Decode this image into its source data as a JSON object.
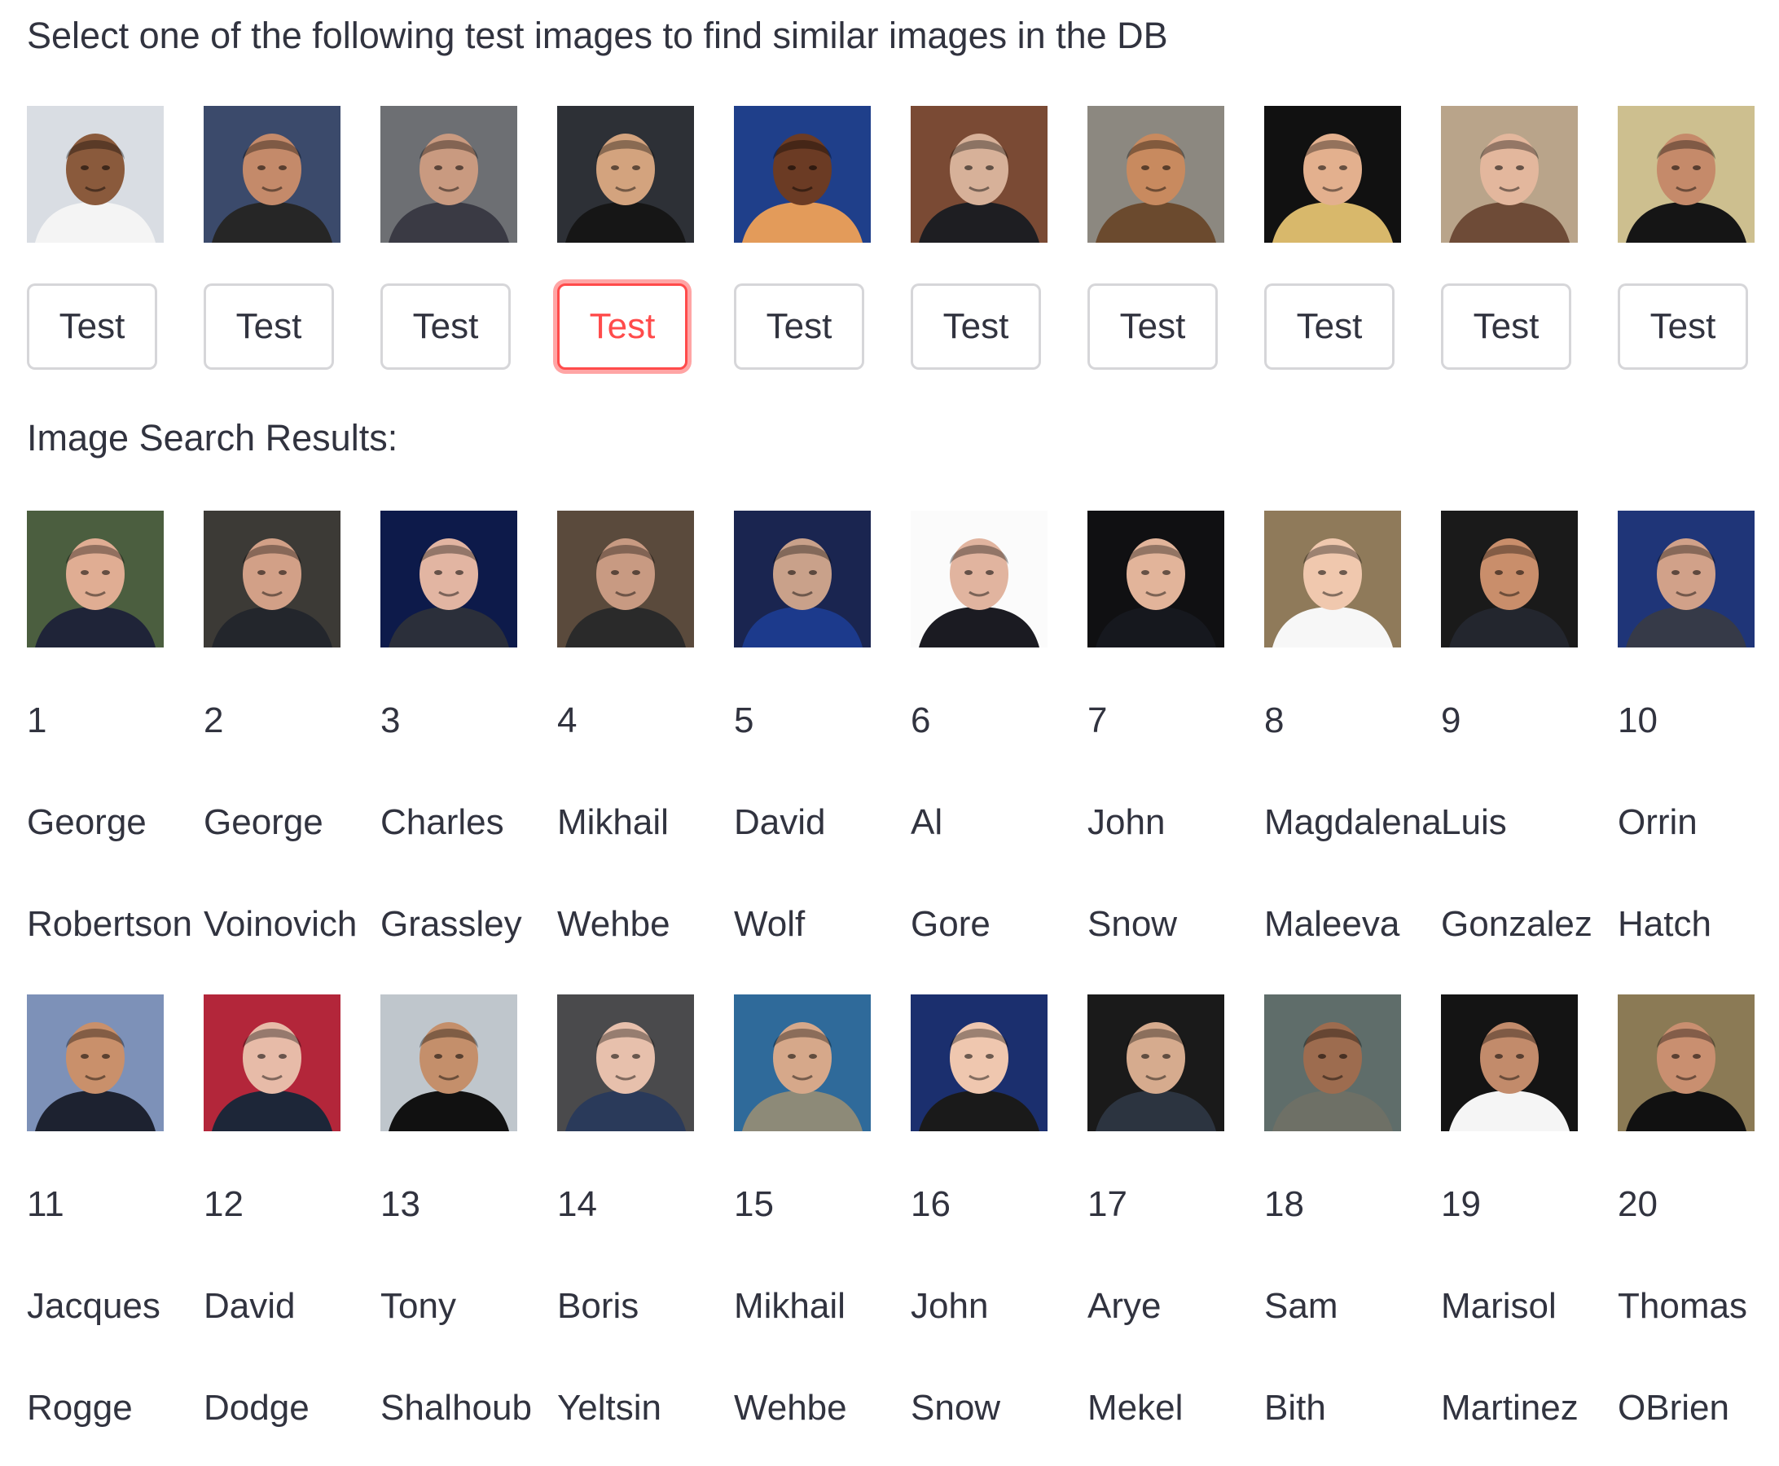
{
  "prompt": "Select one of the following test images to find similar images in the DB",
  "results_title": "Image Search Results:",
  "accent_color": "#ff4b4b",
  "selected_test_index": 3,
  "test_buttons": [
    "Test",
    "Test",
    "Test",
    "Test",
    "Test",
    "Test",
    "Test",
    "Test",
    "Test",
    "Test"
  ],
  "results": [
    {
      "rank": "1",
      "first": "George",
      "last": "Robertson"
    },
    {
      "rank": "2",
      "first": "George",
      "last": "Voinovich"
    },
    {
      "rank": "3",
      "first": "Charles",
      "last": "Grassley"
    },
    {
      "rank": "4",
      "first": "Mikhail",
      "last": "Wehbe"
    },
    {
      "rank": "5",
      "first": "David",
      "last": "Wolf"
    },
    {
      "rank": "6",
      "first": "Al",
      "last": "Gore"
    },
    {
      "rank": "7",
      "first": "John",
      "last": "Snow"
    },
    {
      "rank": "8",
      "first": "Magdalena",
      "last": "Maleeva"
    },
    {
      "rank": "9",
      "first": "Luis",
      "last": "Gonzalez"
    },
    {
      "rank": "10",
      "first": "Orrin",
      "last": "Hatch"
    },
    {
      "rank": "11",
      "first": "Jacques",
      "last": "Rogge"
    },
    {
      "rank": "12",
      "first": "David",
      "last": "Dodge"
    },
    {
      "rank": "13",
      "first": "Tony",
      "last": "Shalhoub"
    },
    {
      "rank": "14",
      "first": "Boris",
      "last": "Yeltsin"
    },
    {
      "rank": "15",
      "first": "Mikhail",
      "last": "Wehbe"
    },
    {
      "rank": "16",
      "first": "John",
      "last": "Snow"
    },
    {
      "rank": "17",
      "first": "Arye",
      "last": "Mekel"
    },
    {
      "rank": "18",
      "first": "Sam",
      "last": "Bith"
    },
    {
      "rank": "19",
      "first": "Marisol",
      "last": "Martinez"
    },
    {
      "rank": "20",
      "first": "Thomas",
      "last": "OBrien"
    }
  ]
}
